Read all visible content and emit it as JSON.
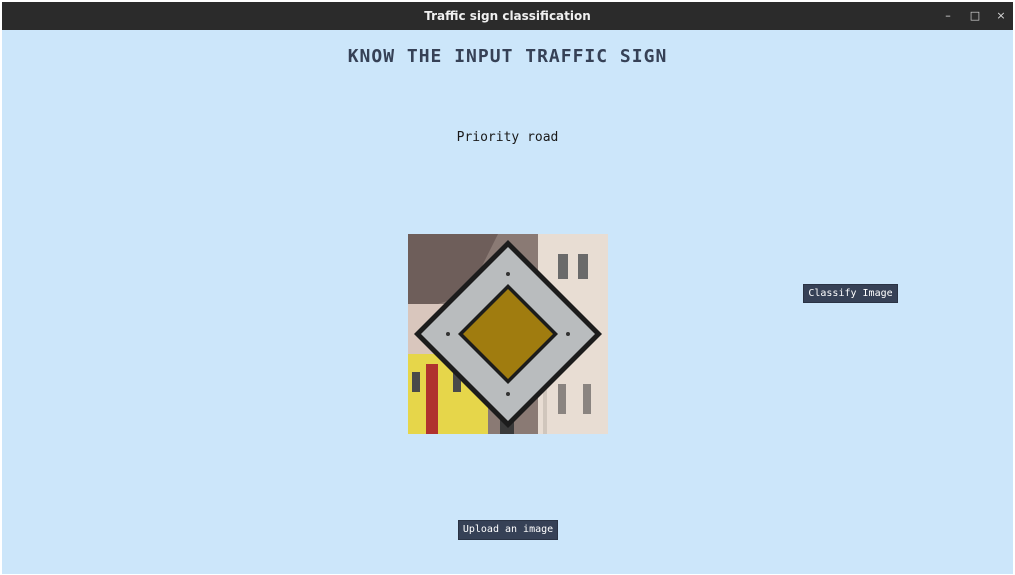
{
  "window": {
    "title": "Traffic sign classification",
    "controls": {
      "minimize": "–",
      "maximize": "□",
      "close": "×"
    }
  },
  "heading": "KNOW THE INPUT TRAFFIC SIGN",
  "result_label": "Priority road",
  "image": {
    "icon": "priority-road-sign-photo"
  },
  "buttons": {
    "classify": "Classify Image",
    "upload": "Upload an image"
  },
  "colors": {
    "background": "#cce6fa",
    "titlebar": "#2b2b2b",
    "button": "#364156",
    "heading": "#364156"
  }
}
